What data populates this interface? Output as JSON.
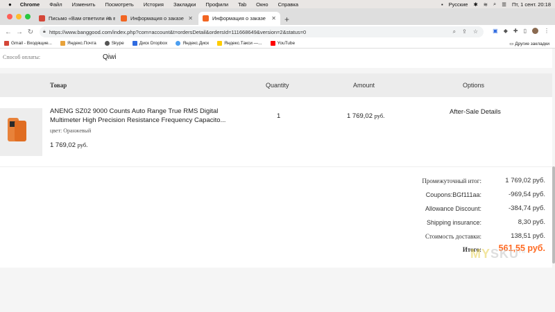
{
  "menubar": {
    "apple": "",
    "app": "Chrome",
    "items": [
      "Файл",
      "Изменить",
      "Посмотреть",
      "История",
      "Закладки",
      "Профили",
      "Tab",
      "Окно",
      "Справка"
    ],
    "input_source": "Русские",
    "clock": "Пт, 1 сент. 20:18"
  },
  "tabs": [
    {
      "label": "Письмо «Вам ответили на во",
      "color": "#d44638"
    },
    {
      "label": "Информация о заказе",
      "color": "#f26522"
    },
    {
      "label": "Информация о заказе",
      "color": "#f26522"
    }
  ],
  "toolbar": {
    "url": "https://www.banggood.com/index.php?com=account&t=ordersDetail&ordersId=111668649&version=2&status=0"
  },
  "bookmarks": [
    {
      "label": "Gmail - Входящие...",
      "color": "#d44638"
    },
    {
      "label": "Яндекс.Почта",
      "color": "#e8a23a"
    },
    {
      "label": "Skype",
      "color": "#555555"
    },
    {
      "label": "Диск Dropbox",
      "color": "#2f6be0"
    },
    {
      "label": "Яндекс.Диск",
      "color": "#4b9ef0"
    },
    {
      "label": "Яндекс.Такси —...",
      "color": "#ffcc00"
    },
    {
      "label": "YouTube",
      "color": "#ff0000"
    }
  ],
  "bookmarks_other": "Другие закладки",
  "payment": {
    "label": "Способ оплаты:",
    "value": "Qiwi"
  },
  "table": {
    "headers": {
      "product": "Товар",
      "quantity": "Quantity",
      "amount": "Amount",
      "options": "Options"
    },
    "row": {
      "name": "ANENG SZ02 9000 Counts Auto Range True RMS Digital Multimeter High Precision Resistance Frequency Capacito...",
      "color": "цвет: Оранжевый",
      "price_value": "1 769,02",
      "price_unit": "руб.",
      "quantity": "1",
      "amount_value": "1 769,02",
      "amount_unit": "руб.",
      "options": "After-Sale Details"
    }
  },
  "summary": {
    "subtotal_label": "Промежуточный итог:",
    "subtotal_value": "1 769,02 руб.",
    "coupons_label": "Coupons:BGf111aa:",
    "coupons_value": "-969,54 руб.",
    "allowance_label": "Allowance Discount:",
    "allowance_value": "-384,74 руб.",
    "shipping_ins_label": "Shipping insurance:",
    "shipping_ins_value": "8,30 руб.",
    "delivery_label": "Стоимость доставки:",
    "delivery_value": "138,51 руб.",
    "total_label": "Итого:",
    "total_value": "561,55 руб."
  },
  "watermark": {
    "left": "MY",
    "right": "SKU",
    "sup": "ru"
  },
  "accent": "#ff6a22"
}
